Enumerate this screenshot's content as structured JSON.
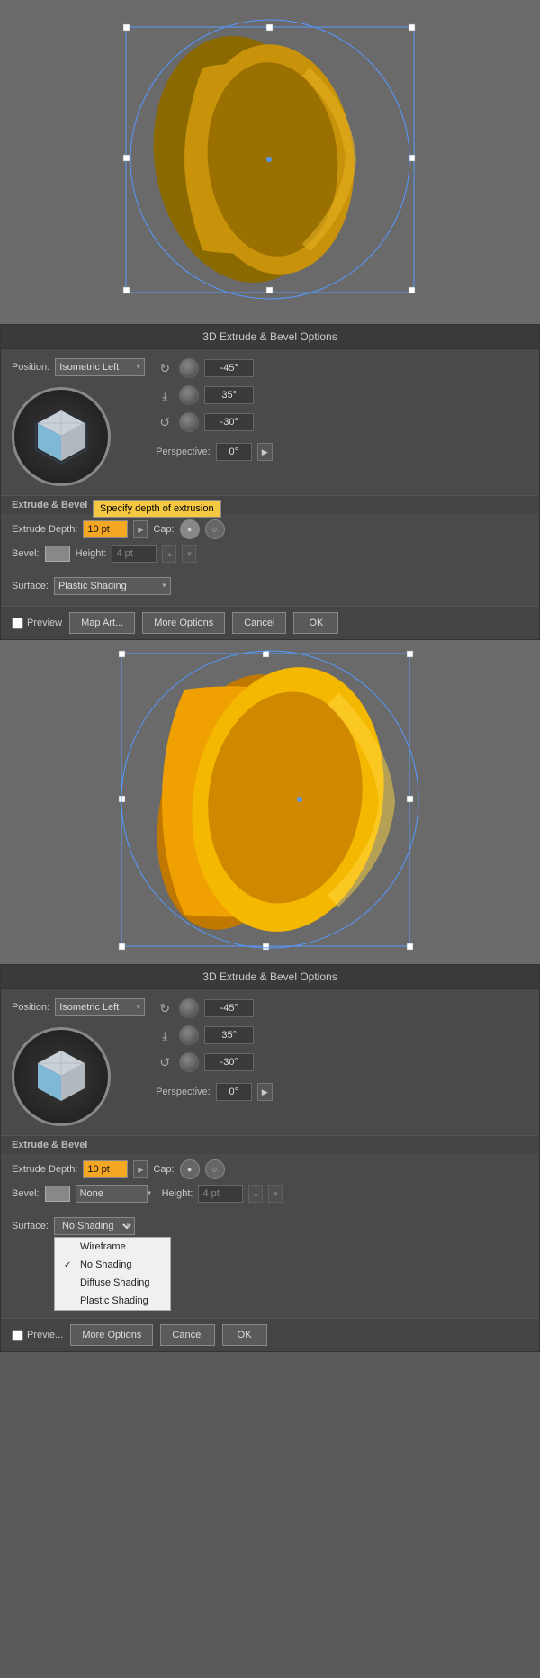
{
  "canvas1": {
    "bg": "#6a6a6a"
  },
  "dialog1": {
    "title": "3D Extrude & Bevel Options",
    "position_label": "Position:",
    "position_value": "Isometric Left",
    "angle1": "-45°",
    "angle2": "35°",
    "angle3": "-30°",
    "perspective_label": "Perspective:",
    "perspective_value": "0°",
    "extrude_section_label": "Extrude & Bevel",
    "extrude_depth_label": "Extrude Depth:",
    "extrude_depth_value": "10 pt",
    "cap_label": "Cap:",
    "bevel_label": "Bevel:",
    "height_label": "Height:",
    "height_value": "4 pt",
    "surface_label": "Surface:",
    "surface_value": "Plastic Shading",
    "tooltip": "Specify depth of extrusion",
    "preview_label": "Preview",
    "map_art_label": "Map Art...",
    "more_options_label": "More Options",
    "cancel_label": "Cancel",
    "ok_label": "OK"
  },
  "canvas2": {
    "bg": "#6a6a6a"
  },
  "dialog2": {
    "title": "3D Extrude & Bevel Options",
    "position_label": "Position:",
    "position_value": "Isometric Left",
    "angle1": "-45°",
    "angle2": "35°",
    "angle3": "-30°",
    "perspective_label": "Perspective:",
    "perspective_value": "0°",
    "extrude_section_label": "Extrude & Bevel",
    "extrude_depth_label": "Extrude Depth:",
    "extrude_depth_value": "10 pt",
    "cap_label": "Cap:",
    "bevel_label": "Bevel:",
    "bevel_value": "None",
    "height_label": "Height:",
    "height_value": "4 pt",
    "surface_label": "Surface:",
    "surface_value": "No Shading",
    "preview_label": "Previe...",
    "more_options_label": "More Options",
    "cancel_label": "Cancel",
    "ok_label": "OK",
    "dropdown": {
      "item1": "Wireframe",
      "item2": "No Shading",
      "item3": "Diffuse Shading",
      "item4": "Plastic Shading"
    }
  }
}
